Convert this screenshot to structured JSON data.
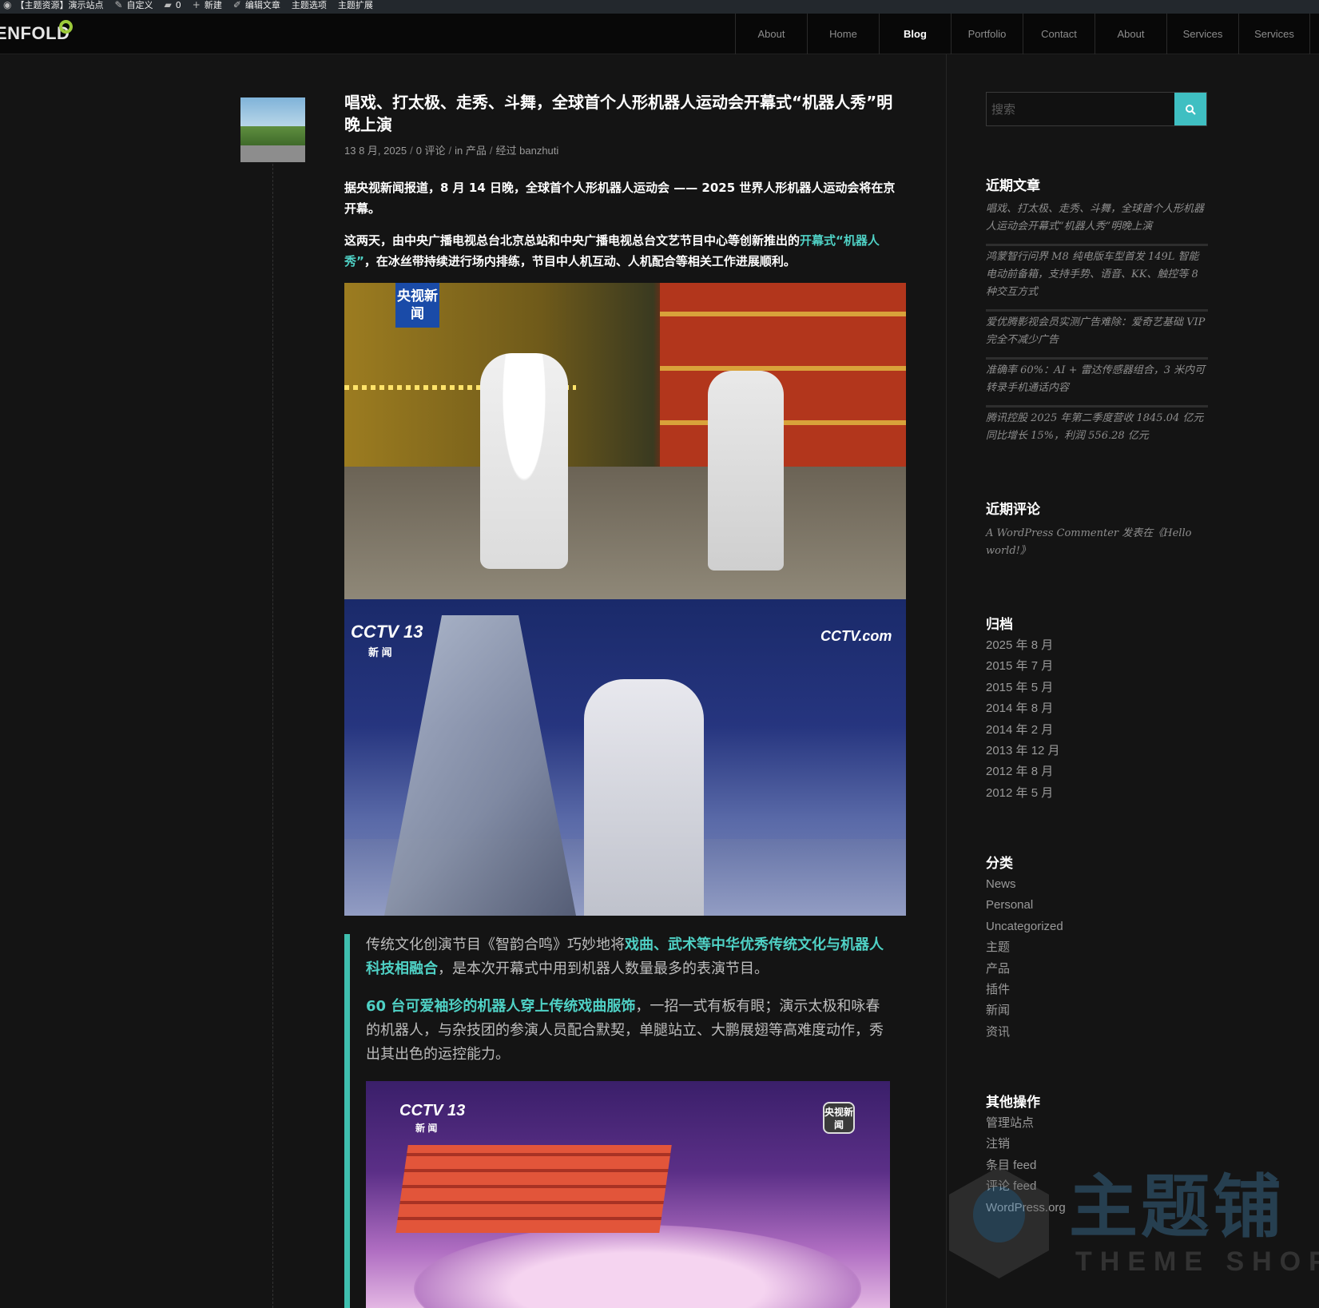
{
  "admin_bar": {
    "items": [
      "【主题资源】演示站点",
      "自定义",
      "0",
      "新建",
      "编辑文章",
      "主题选项",
      "主题扩展"
    ]
  },
  "header": {
    "logo": "ENFOLD",
    "nav": [
      "About",
      "Home",
      "Blog",
      "Portfolio",
      "Contact",
      "About",
      "Services",
      "Services"
    ],
    "active_nav": "Blog"
  },
  "post": {
    "title": "唱戏、打太极、走秀、斗舞，全球首个人形机器人运动会开幕式“机器人秀”明晚上演",
    "meta": {
      "date": "13 8 月, 2025",
      "comments": "0 评论",
      "category": "in 产品",
      "author": "经过 banzhuti"
    },
    "para1": "据央视新闻报道，8 月 14 日晚，全球首个人形机器人运动会 —— 2025 世界人形机器人运动会将在京开幕。",
    "para2_a": "这两天，由中央广播电视总台北京总站和中央广播电视总台文艺节目中心等创新推出的",
    "para2_link": "开幕式“机器人秀”",
    "para2_b": "，在冰丝带持续进行场内排练，节目中人机互动、人机配合等相关工作进展顺利。",
    "image1_badge": "央视新闻",
    "image2_logo": "CCTV 13",
    "image2_logo_sub": "新 闻",
    "image2_logo_right": "CCTV.com",
    "quote1_a": "传统文化创演节目《智韵合鸣》巧妙地将",
    "quote1_hl": "戏曲、武术等中华优秀传统文化与机器人科技相融合",
    "quote1_b": "，是本次开幕式中用到机器人数量最多的表演节目。",
    "quote2_hl": "60 台可爱袖珍的机器人穿上传统戏曲服饰",
    "quote2_b": "，一招一式有板有眼；演示太极和咏春的机器人，与杂技团的参演人员配合默契，单腿站立、大鹏展翅等高难度动作，秀出其出色的运控能力。",
    "image3_logo": "CCTV 13",
    "image3_logo_sub": "新 闻",
    "image3_badge": "央视新闻"
  },
  "sidebar": {
    "search_placeholder": "搜索",
    "recent_posts_title": "近期文章",
    "recent_posts": [
      "唱戏、打太极、走秀、斗舞，全球首个人形机器人运动会开幕式“机器人秀”明晚上演",
      "鸿蒙智行问界 M8 纯电版车型首发 149L 智能电动前备箱，支持手势、语音、KK、触控等 8 种交互方式",
      "爱优腾影视会员实测广告难除：爱奇艺基础 VIP 完全不减少广告",
      "准确率 60%：AI + 雷达传感器组合，3 米内可转录手机通话内容",
      "腾讯控股 2025 年第二季度营收 1845.04 亿元 同比增长 15%，利润 556.28 亿元"
    ],
    "recent_comments_title": "近期评论",
    "recent_comment": "A WordPress Commenter 发表在《Hello world!》",
    "archives_title": "归档",
    "archives": [
      "2025 年 8 月",
      "2015 年 7 月",
      "2015 年 5 月",
      "2014 年 8 月",
      "2014 年 2 月",
      "2013 年 12 月",
      "2012 年 8 月",
      "2012 年 5 月"
    ],
    "categories_title": "分类",
    "categories": [
      "News",
      "Personal",
      "Uncategorized",
      "主题",
      "产品",
      "插件",
      "新闻",
      "资讯"
    ],
    "meta_title": "其他操作",
    "meta_links": [
      "管理站点",
      "注销",
      "条目 feed",
      "评论 feed",
      "WordPress.org"
    ]
  },
  "watermark": {
    "main": "主题铺",
    "sub": "THEME SHOP"
  },
  "colors": {
    "accent": "#3fbfc2",
    "highlight_text": "#4fd1c5",
    "background": "#141414",
    "logo_ring": "#9cc93a"
  }
}
